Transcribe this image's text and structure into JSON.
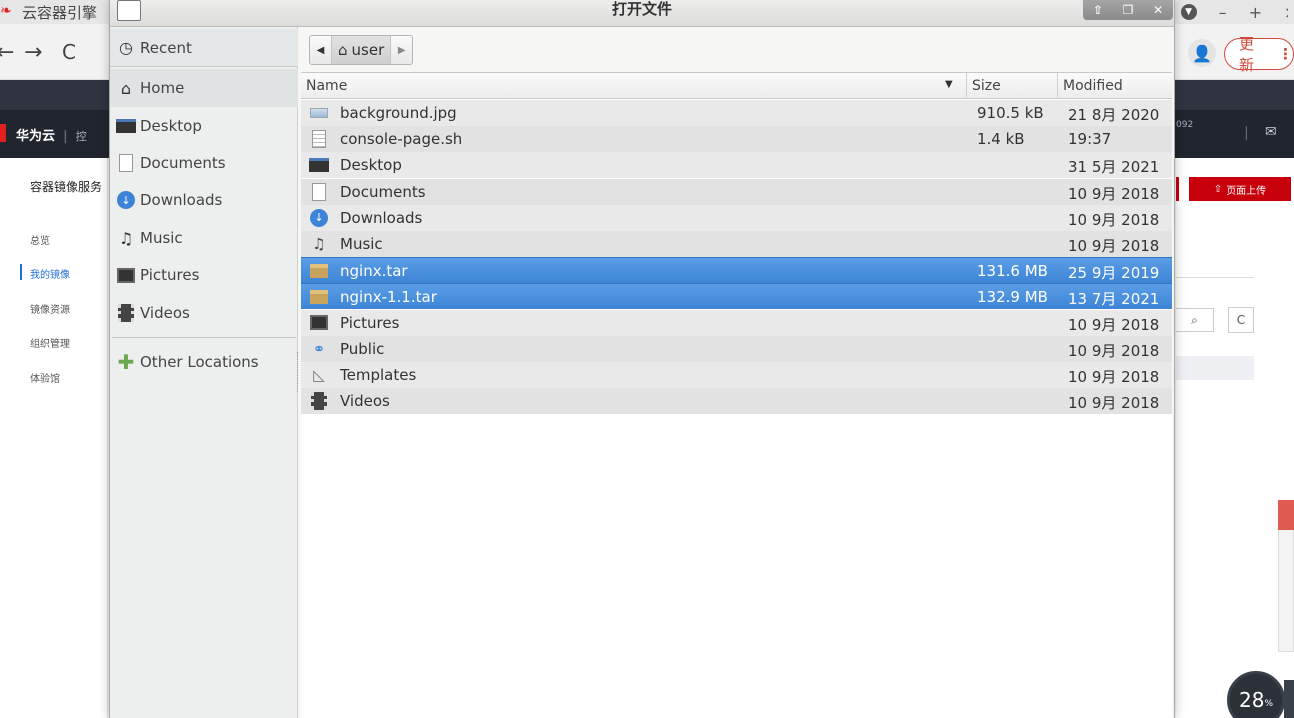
{
  "browser": {
    "tab_title": "云容器引擎",
    "update_label": "更新",
    "more_label": "⋮"
  },
  "console": {
    "brand": "华为云",
    "brand_extra": "控",
    "header_extra": "092",
    "nav_title": "容器镜像服务",
    "nav_items": [
      {
        "label": "总览"
      },
      {
        "label": "我的镜像"
      },
      {
        "label": "镜像资源"
      },
      {
        "label": "组织管理"
      },
      {
        "label": "体验馆"
      }
    ],
    "upload_label": "页面上传",
    "speed_value": "28",
    "speed_unit": "%"
  },
  "dialog": {
    "title": "打开文件",
    "places": [
      {
        "label": "Recent",
        "icon": "clock-icon"
      },
      {
        "label": "Home",
        "icon": "home-icon"
      },
      {
        "label": "Desktop",
        "icon": "desktop-icon"
      },
      {
        "label": "Documents",
        "icon": "document-icon"
      },
      {
        "label": "Downloads",
        "icon": "download-icon"
      },
      {
        "label": "Music",
        "icon": "music-icon"
      },
      {
        "label": "Pictures",
        "icon": "pictures-icon"
      },
      {
        "label": "Videos",
        "icon": "videos-icon"
      },
      {
        "label": "Other Locations",
        "icon": "plus-icon"
      }
    ],
    "path_crumb": "user",
    "columns": {
      "name": "Name",
      "size": "Size",
      "modified": "Modified"
    },
    "files": [
      {
        "name": "background.jpg",
        "size": "910.5 kB",
        "modified": "21 8月 2020",
        "icon": "image-file-icon",
        "selected": false
      },
      {
        "name": "console-page.sh",
        "size": "1.4 kB",
        "modified": "19:37",
        "icon": "script-file-icon",
        "selected": false
      },
      {
        "name": "Desktop",
        "size": "",
        "modified": "31 5月 2021",
        "icon": "desktop-folder-icon",
        "selected": false
      },
      {
        "name": "Documents",
        "size": "",
        "modified": "10 9月 2018",
        "icon": "document-folder-icon",
        "selected": false
      },
      {
        "name": "Downloads",
        "size": "",
        "modified": "10 9月 2018",
        "icon": "download-folder-icon",
        "selected": false
      },
      {
        "name": "Music",
        "size": "",
        "modified": "10 9月 2018",
        "icon": "music-folder-icon",
        "selected": false
      },
      {
        "name": "nginx.tar",
        "size": "131.6 MB",
        "modified": "25 9月 2019",
        "icon": "archive-file-icon",
        "selected": true
      },
      {
        "name": "nginx-1.1.tar",
        "size": "132.9 MB",
        "modified": "13 7月 2021",
        "icon": "archive-file-icon",
        "selected": true
      },
      {
        "name": "Pictures",
        "size": "",
        "modified": "10 9月 2018",
        "icon": "pictures-folder-icon",
        "selected": false
      },
      {
        "name": "Public",
        "size": "",
        "modified": "10 9月 2018",
        "icon": "public-folder-icon",
        "selected": false
      },
      {
        "name": "Templates",
        "size": "",
        "modified": "10 9月 2018",
        "icon": "templates-folder-icon",
        "selected": false
      },
      {
        "name": "Videos",
        "size": "",
        "modified": "10 9月 2018",
        "icon": "videos-folder-icon",
        "selected": false
      }
    ]
  }
}
